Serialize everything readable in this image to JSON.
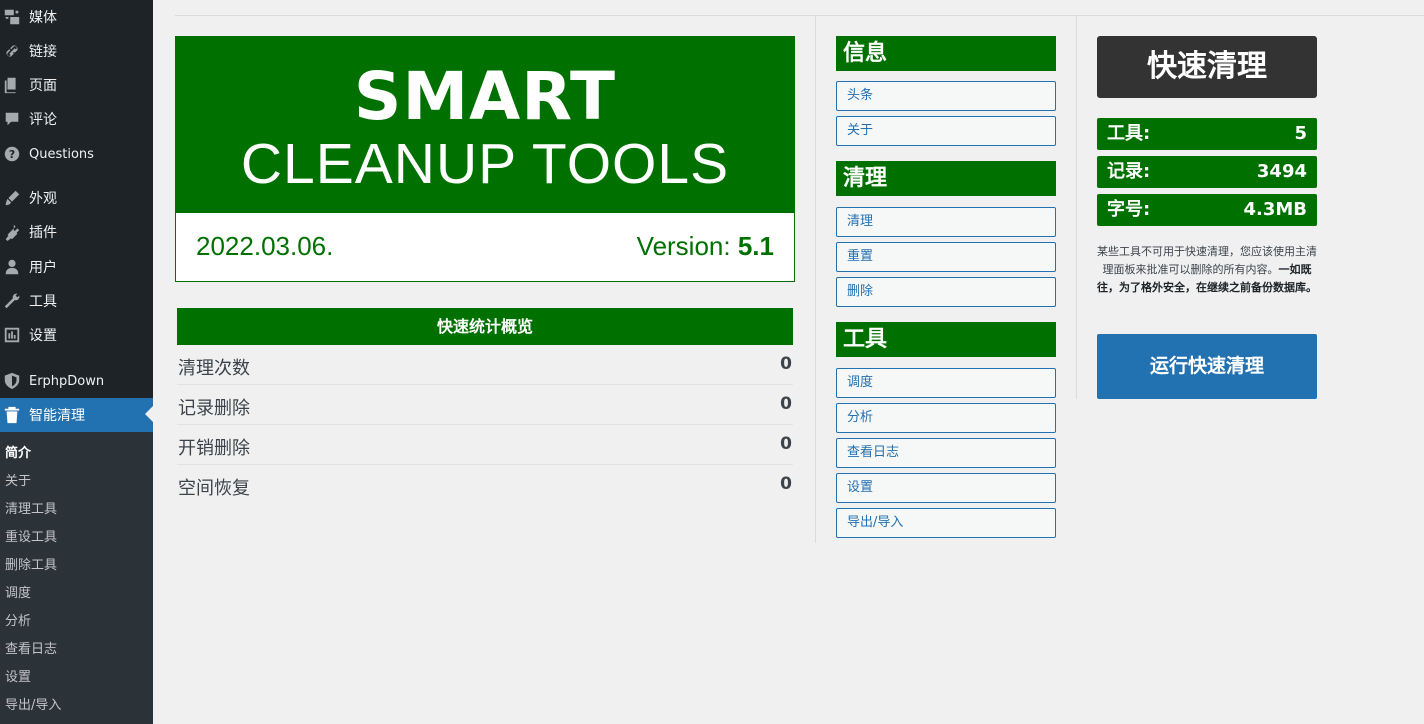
{
  "sidebar": {
    "items": [
      {
        "label": "媒体",
        "icon": "media-icon"
      },
      {
        "label": "链接",
        "icon": "link-icon"
      },
      {
        "label": "页面",
        "icon": "page-icon"
      },
      {
        "label": "评论",
        "icon": "comment-icon"
      },
      {
        "label": "Questions",
        "icon": "question-icon"
      },
      {
        "label": "外观",
        "icon": "appearance-icon"
      },
      {
        "label": "插件",
        "icon": "plugin-icon"
      },
      {
        "label": "用户",
        "icon": "user-icon"
      },
      {
        "label": "工具",
        "icon": "wrench-icon"
      },
      {
        "label": "设置",
        "icon": "settings-icon"
      },
      {
        "label": "ErphpDown",
        "icon": "shield-icon"
      },
      {
        "label": "智能清理",
        "icon": "trash-icon"
      }
    ],
    "submenu": [
      "简介",
      "关于",
      "清理工具",
      "重设工具",
      "删除工具",
      "调度",
      "分析",
      "查看日志",
      "设置",
      "导出/导入"
    ]
  },
  "logo": {
    "line1": "SMART",
    "line2": "CLEANUP TOOLS",
    "date": "2022.03.06.",
    "version_label": "Version:",
    "version_number": "5.1"
  },
  "stats": {
    "header": "快速统计概览",
    "rows": [
      {
        "label": "清理次数",
        "value": "0"
      },
      {
        "label": "记录删除",
        "value": "0"
      },
      {
        "label": "开销删除",
        "value": "0"
      },
      {
        "label": "空间恢复",
        "value": "0"
      }
    ]
  },
  "menu": {
    "sections": [
      {
        "title": "信息",
        "items": [
          "头条",
          "关于"
        ]
      },
      {
        "title": "清理",
        "items": [
          "清理",
          "重置",
          "删除"
        ]
      },
      {
        "title": "工具",
        "items": [
          "调度",
          "分析",
          "查看日志",
          "设置",
          "导出/导入"
        ]
      }
    ]
  },
  "quick": {
    "title": "快速清理",
    "rows": [
      {
        "label": "工具:",
        "value": "5"
      },
      {
        "label": "记录:",
        "value": "3494"
      },
      {
        "label": "字号:",
        "value": "4.3MB"
      }
    ],
    "note_normal": "某些工具不可用于快速清理，您应该使用主清理面板来批准可以删除的所有内容。",
    "note_bold": "一如既往，为了格外安全，在继续之前备份数据库。",
    "run_button": "运行快速清理"
  },
  "colors": {
    "brand_green": "#007100",
    "sidebar_bg": "#1d2327",
    "active_blue": "#2271b1"
  }
}
